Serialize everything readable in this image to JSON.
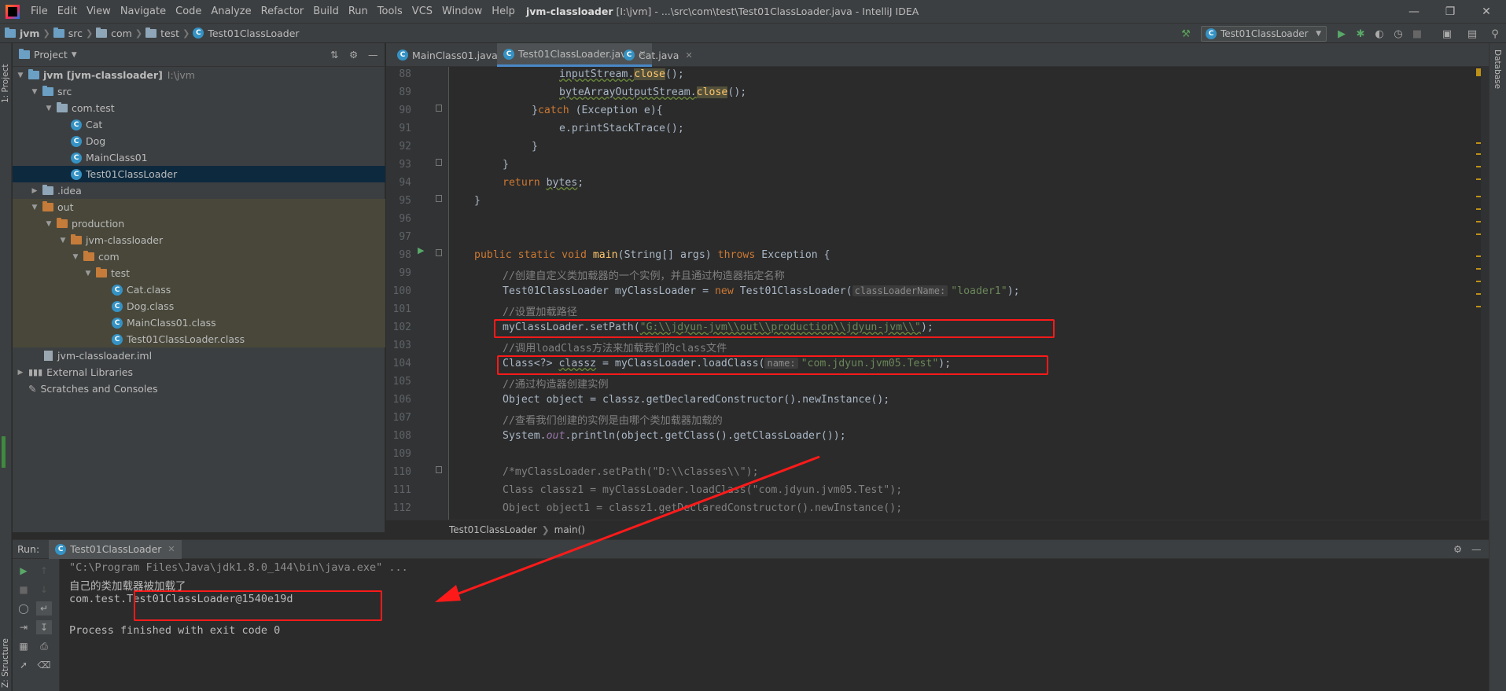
{
  "menubar": {
    "items": [
      "File",
      "Edit",
      "View",
      "Navigate",
      "Code",
      "Analyze",
      "Refactor",
      "Build",
      "Run",
      "Tools",
      "VCS",
      "Window",
      "Help"
    ],
    "title_project": "jvm-classloader",
    "title_rest": " [I:\\jvm] - ...\\src\\com\\test\\Test01ClassLoader.java - IntelliJ IDEA"
  },
  "navbar": {
    "crumbs": [
      "jvm",
      "src",
      "com",
      "test",
      "Test01ClassLoader"
    ],
    "run_config": "Test01ClassLoader"
  },
  "side_tabs": {
    "left_project": "1: Project",
    "left_structure": "Z: Structure",
    "right_database": "Database"
  },
  "project": {
    "header": "Project",
    "tree": [
      {
        "label": "jvm [jvm-classloader]",
        "extra": "I:\\jvm"
      },
      {
        "label": "src"
      },
      {
        "label": "com.test"
      },
      {
        "label": "Cat"
      },
      {
        "label": "Dog"
      },
      {
        "label": "MainClass01"
      },
      {
        "label": "Test01ClassLoader"
      },
      {
        "label": ".idea"
      },
      {
        "label": "out"
      },
      {
        "label": "production"
      },
      {
        "label": "jvm-classloader"
      },
      {
        "label": "com"
      },
      {
        "label": "test"
      },
      {
        "label": "Cat.class"
      },
      {
        "label": "Dog.class"
      },
      {
        "label": "MainClass01.class"
      },
      {
        "label": "Test01ClassLoader.class"
      },
      {
        "label": "jvm-classloader.iml"
      },
      {
        "label": "External Libraries"
      },
      {
        "label": "Scratches and Consoles"
      }
    ]
  },
  "tabs": [
    "MainClass01.java",
    "Test01ClassLoader.java",
    "Cat.java"
  ],
  "editor": {
    "line_numbers": [
      "88",
      "89",
      "90",
      "91",
      "92",
      "93",
      "94",
      "95",
      "96",
      "97",
      "98",
      "99",
      "100",
      "101",
      "102",
      "103",
      "104",
      "105",
      "106",
      "107",
      "108",
      "109",
      "110",
      "111",
      "112"
    ],
    "c88a": "inputStream.",
    "c88b": "close",
    "c88c": "();",
    "c89a": "byteArrayOutputStream.",
    "c89b": "close",
    "c89c": "();",
    "c90a": "}",
    "c90b": "catch",
    "c90c": " (Exception e){",
    "c91": "e.printStackTrace();",
    "c92": "}",
    "c93": "}",
    "c94a": "return",
    "c94b": "bytes",
    "c94c": ";",
    "c95": "}",
    "c98a": "public static void ",
    "c98b": "main",
    "c98c": "(String[] args) ",
    "c98d": "throws",
    "c98e": " Exception {",
    "c99": "//创建自定义类加载器的一个实例，并且通过构造器指定名称",
    "c100a": "Test01ClassLoader myClassLoader = ",
    "c100b": "new",
    "c100c": " Test01ClassLoader(",
    "c100hint": "classLoaderName:",
    "c100d": "\"loader1\"",
    "c100e": ");",
    "c101": "//设置加载路径",
    "c102a": "myClassLoader.setPath(",
    "c102b": "\"G:\\\\jdyun-jvm\\\\out\\\\production\\\\jdyun-jvm\\\\\"",
    "c102c": ");",
    "c103": "//调用loadClass方法来加载我们的class文件",
    "c104a": "Class<?> ",
    "c104b": "classz",
    "c104c": " = myClassLoader.loadClass(",
    "c104hint": "name:",
    "c104d": "\"com.jdyun.jvm05.Test\"",
    "c104e": ");",
    "c105": "//通过构造器创建实例",
    "c106": "Object object = classz.getDeclaredConstructor().newInstance();",
    "c107": "//查看我们创建的实例是由哪个类加载器加载的",
    "c108a": "System.",
    "c108b": "out",
    "c108c": ".println(object.getClass().getClassLoader());",
    "c110": "/*myClassLoader.setPath(\"D:\\\\classes\\\\\");",
    "c111": "Class classz1 = myClassLoader.loadClass(\"com.jdyun.jvm05.Test\");",
    "c112": "Object object1 = classz1.getDeclaredConstructor().newInstance();"
  },
  "editor_crumbs": [
    "Test01ClassLoader",
    "main()"
  ],
  "run": {
    "label": "Run:",
    "tab": "Test01ClassLoader",
    "console": [
      "\"C:\\Program Files\\Java\\jdk1.8.0_144\\bin\\java.exe\" ...",
      "自己的类加载器被加载了",
      "com.test.Test01ClassLoader@1540e19d",
      "",
      "Process finished with exit code 0"
    ]
  },
  "colors": {
    "annotation_red": "#ff1a1a",
    "accent": "#4a88c7"
  }
}
